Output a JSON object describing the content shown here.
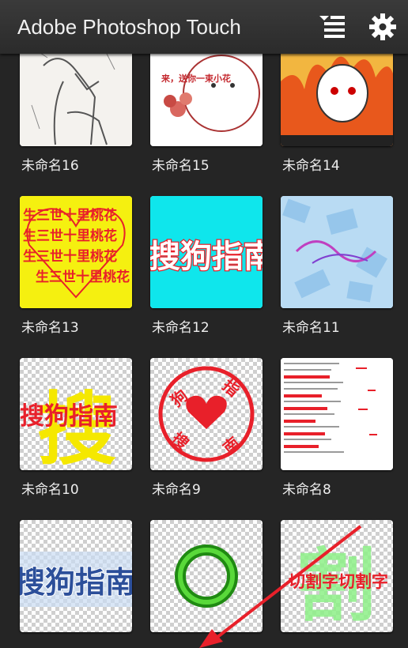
{
  "app": {
    "title": "Adobe Photoshop Touch"
  },
  "toolbar": {
    "sort_icon": "sort-menu-icon",
    "settings_icon": "gear-icon"
  },
  "projects": [
    {
      "name": "未命名16",
      "thumb_text": ""
    },
    {
      "name": "未命名15",
      "thumb_text": "来，送你一束小花"
    },
    {
      "name": "未命名14",
      "thumb_text": ""
    },
    {
      "name": "未命名13",
      "thumb_text": "生三世十里桃花"
    },
    {
      "name": "未命名12",
      "thumb_text": "搜狗指南"
    },
    {
      "name": "未命名11",
      "thumb_text": ""
    },
    {
      "name": "未命名10",
      "thumb_text": "搜狗指南",
      "thumb_big_char": "搜"
    },
    {
      "name": "未命名9",
      "thumb_text": "搜狗指南"
    },
    {
      "name": "未命名8",
      "thumb_text": ""
    },
    {
      "name": "",
      "thumb_text": "搜狗指南"
    },
    {
      "name": "",
      "thumb_text": ""
    },
    {
      "name": "",
      "thumb_text": "切割字切割字"
    }
  ],
  "colors": {
    "accent_red": "#e8202a",
    "header_bg": "#333333",
    "body_bg": "#252525"
  }
}
